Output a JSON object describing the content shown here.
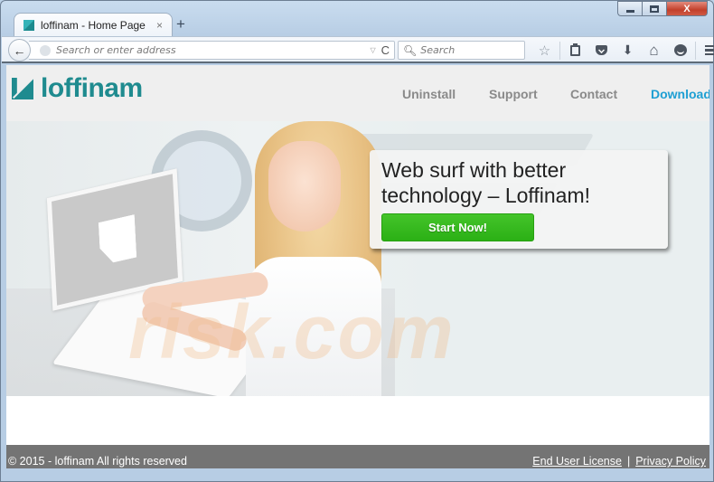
{
  "browser": {
    "tab": {
      "title": "loffinam - Home Page",
      "close_glyph": "×"
    },
    "new_tab_glyph": "+",
    "window_controls": {
      "close_glyph": "X"
    },
    "navbar": {
      "back_glyph": "🡐",
      "address_placeholder": "Search or enter address",
      "address_value": "",
      "dropdown_glyph": "▽",
      "reload_glyph": "C",
      "search_placeholder": "Search",
      "search_glyph": "⚲",
      "icons": [
        "star-icon",
        "reading-list-icon",
        "pocket-icon",
        "download-icon",
        "home-icon",
        "hello-icon",
        "menu-icon"
      ],
      "star_glyph": "☆",
      "download_glyph": "⬇",
      "home_glyph": "⌂"
    }
  },
  "site": {
    "brand_color": "#1f8b8f",
    "accent_color": "#1e9fd3",
    "logo_text": "loffinam",
    "nav": [
      {
        "label": "Uninstall",
        "active": false
      },
      {
        "label": "Support",
        "active": false
      },
      {
        "label": "Contact",
        "active": false
      },
      {
        "label": "Download",
        "active": true
      }
    ],
    "hero": {
      "headline": "Web surf with better technology – Loffinam!",
      "cta_label": "Start Now!",
      "cta_color": "#35b81f",
      "watermark_text": "risk.com"
    },
    "footer": {
      "copyright": "© 2015 - loffinam All rights reserved",
      "links": [
        "End User License",
        "Privacy Policy"
      ],
      "separator": "|"
    }
  }
}
